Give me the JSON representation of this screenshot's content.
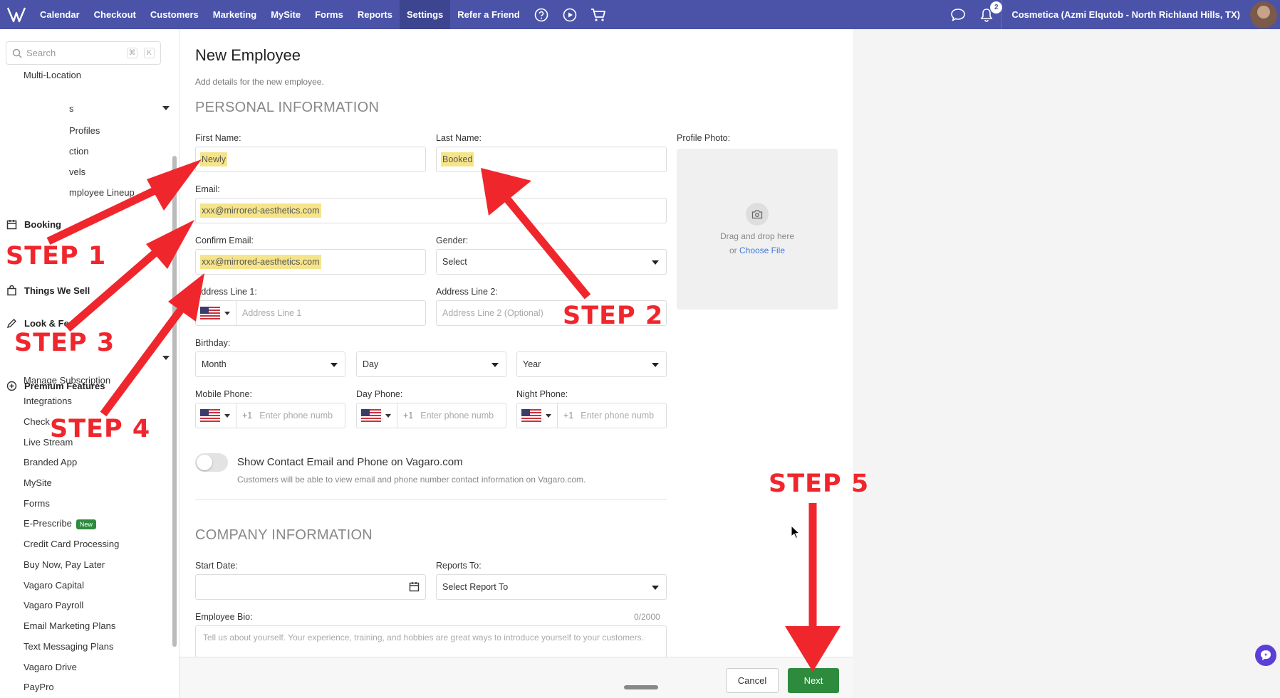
{
  "nav": {
    "items": [
      "Calendar",
      "Checkout",
      "Customers",
      "Marketing",
      "MySite",
      "Forms",
      "Reports",
      "Settings",
      "Refer a Friend"
    ],
    "notification_count": "2",
    "business": "Cosmetica (Azmi Elqutob - North Richland Hills, TX)"
  },
  "sidebar": {
    "search_placeholder": "Search",
    "kbd1": "⌘",
    "kbd2": "K",
    "multi_location": "Multi-Location",
    "sub_partial": "s",
    "profiles": "Profiles",
    "ction": "ction",
    "vels": "vels",
    "lineup": "mployee Lineup",
    "booking": "Booking",
    "things_we_sell": "Things We Sell",
    "look_feel": "Look & Fe",
    "premium": "Premium Features",
    "items": [
      "Manage Subscription",
      "Integrations",
      "Check",
      "Live Stream",
      "Branded App",
      "MySite",
      "Forms",
      "E-Prescribe",
      "Credit Card Processing",
      "Buy Now, Pay Later",
      "Vagaro Capital",
      "Vagaro Payroll",
      "Email Marketing Plans",
      "Text Messaging Plans",
      "Vagaro Drive",
      "PayPro"
    ],
    "new_badge": "New"
  },
  "form": {
    "title": "New Employee",
    "subtitle": "Add details for the new employee.",
    "personal_header": "PERSONAL INFORMATION",
    "first_name_label": "First Name:",
    "first_name_value": "Newly",
    "last_name_label": "Last Name:",
    "last_name_value": "Booked",
    "profile_photo_label": "Profile Photo:",
    "drag_text": "Drag and drop here",
    "or_text": "or",
    "choose_file": "Choose File",
    "email_label": "Email:",
    "email_value": "xxx@mirrored-aesthetics.com",
    "confirm_email_label": "Confirm Email:",
    "confirm_email_value": "xxx@mirrored-aesthetics.com",
    "gender_label": "Gender:",
    "gender_value": "Select",
    "address1_label": "Address Line 1:",
    "address1_placeholder": "Address Line 1",
    "address2_label": "Address Line 2:",
    "address2_placeholder": "Address Line 2 (Optional)",
    "birthday_label": "Birthday:",
    "month": "Month",
    "day": "Day",
    "year": "Year",
    "mobile_label": "Mobile Phone:",
    "day_phone_label": "Day Phone:",
    "night_phone_label": "Night Phone:",
    "phone_prefix": "+1",
    "phone_placeholder": "Enter phone numb",
    "toggle_title": "Show Contact Email and Phone on Vagaro.com",
    "toggle_desc": "Customers will be able to view email and phone number contact information on Vagaro.com.",
    "company_header": "COMPANY INFORMATION",
    "start_date_label": "Start Date:",
    "reports_to_label": "Reports To:",
    "reports_to_value": "Select Report To",
    "bio_label": "Employee Bio:",
    "bio_counter": "0/2000",
    "bio_placeholder": "Tell us about yourself. Your experience, training, and hobbies are great ways to introduce yourself to your customers."
  },
  "footer": {
    "cancel": "Cancel",
    "next": "Next"
  },
  "annotations": {
    "step1": "STEP 1",
    "step2": "STEP 2",
    "step3": "STEP 3",
    "step4": "STEP 4",
    "step5": "STEP 5",
    "color": "#f0262d"
  },
  "colors": {
    "nav_bg": "#4a53a8",
    "highlight": "#f6e48a",
    "next_button": "#2e8b3e"
  }
}
